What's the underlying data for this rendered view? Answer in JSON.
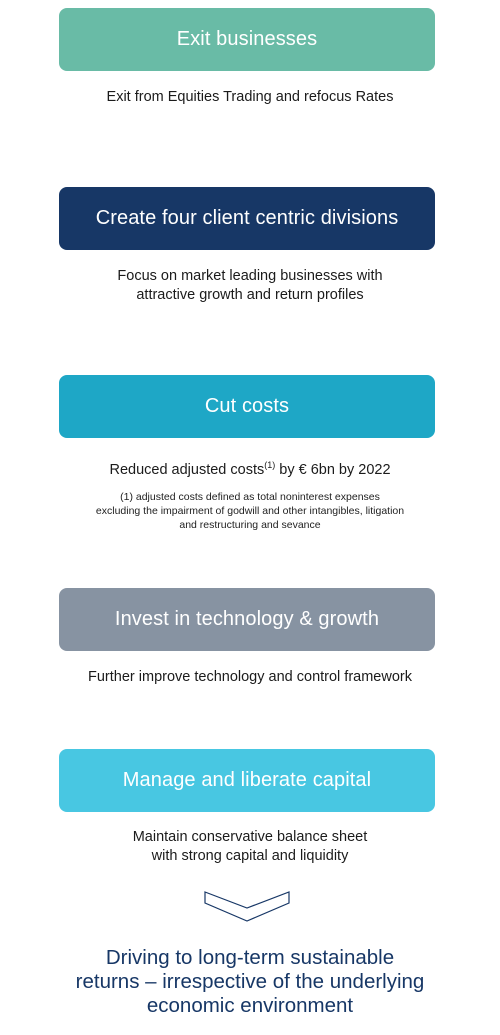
{
  "colors": {
    "exit": "#69bba6",
    "divisions": "#173766",
    "costs": "#1ea7c6",
    "invest": "#8793a2",
    "capital": "#48c7e2",
    "closing_text": "#173766",
    "chevron_stroke": "#173766"
  },
  "steps": [
    {
      "title": "Exit businesses",
      "description": [
        "Exit from Equities Trading and refocus Rates"
      ]
    },
    {
      "title": "Create four client centric divisions",
      "description": [
        "Focus on market leading businesses with",
        "attractive growth and return profiles"
      ]
    },
    {
      "title": "Cut costs",
      "description_prefix": "Reduced adjusted costs",
      "description_sup": "(1)",
      "description_suffix": " by € 6bn by 2022",
      "footnote": [
        "(1) adjusted costs defined as total noninterest expenses",
        "excluding the impairment of godwill and other intangibles, litigation",
        "and restructuring and sevance"
      ]
    },
    {
      "title": "Invest in technology & growth",
      "description": [
        "Further improve technology and control framework"
      ]
    },
    {
      "title": "Manage and liberate capital",
      "description": [
        "Maintain conservative balance sheet",
        "with strong capital and liquidity"
      ]
    }
  ],
  "arrow_icon": "chevron-down-icon",
  "closing": [
    "Driving to long-term sustainable",
    "returns – irrespective of the underlying",
    "economic environment"
  ]
}
